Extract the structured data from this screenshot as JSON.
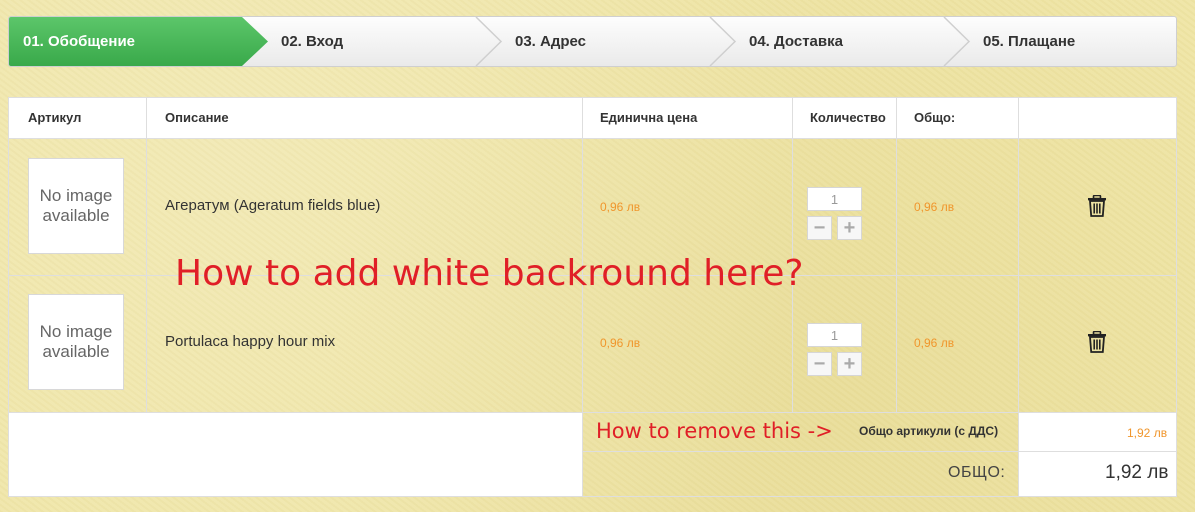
{
  "steps": [
    {
      "label": "01. Обобщение",
      "active": true
    },
    {
      "label": "02. Вход",
      "active": false
    },
    {
      "label": "03. Адрес",
      "active": false
    },
    {
      "label": "04. Доставка",
      "active": false
    },
    {
      "label": "05. Плащане",
      "active": false
    }
  ],
  "table": {
    "headers": {
      "article": "Артикул",
      "description": "Описание",
      "unit_price": "Единична цена",
      "quantity": "Количество",
      "total": "Общо:"
    },
    "rows": [
      {
        "image_text_1": "No image",
        "image_text_2": "available",
        "description": "Агератум (Ageratum fields blue)",
        "unit_price": "0,96 лв",
        "quantity": "1",
        "total": "0,96 лв"
      },
      {
        "image_text_1": "No image",
        "image_text_2": "available",
        "description": "Portulaca happy hour mix",
        "unit_price": "0,96 лв",
        "quantity": "1",
        "total": "0,96 лв"
      }
    ],
    "qty_minus": "−",
    "qty_plus": "+",
    "subtotal_label": "Общо артикули (с ДДС)",
    "subtotal_value": "1,92 лв",
    "grand_total_label": "ОБЩО:",
    "grand_total_value": "1,92 лв"
  },
  "annotations": {
    "top": "How to add white backround here?",
    "bottom": "How to remove this ->"
  },
  "icons": {
    "delete": "trash-icon"
  },
  "colors": {
    "accent_green": "#45b055",
    "price_orange": "#f0962c",
    "annotation_red": "#e01f27"
  }
}
